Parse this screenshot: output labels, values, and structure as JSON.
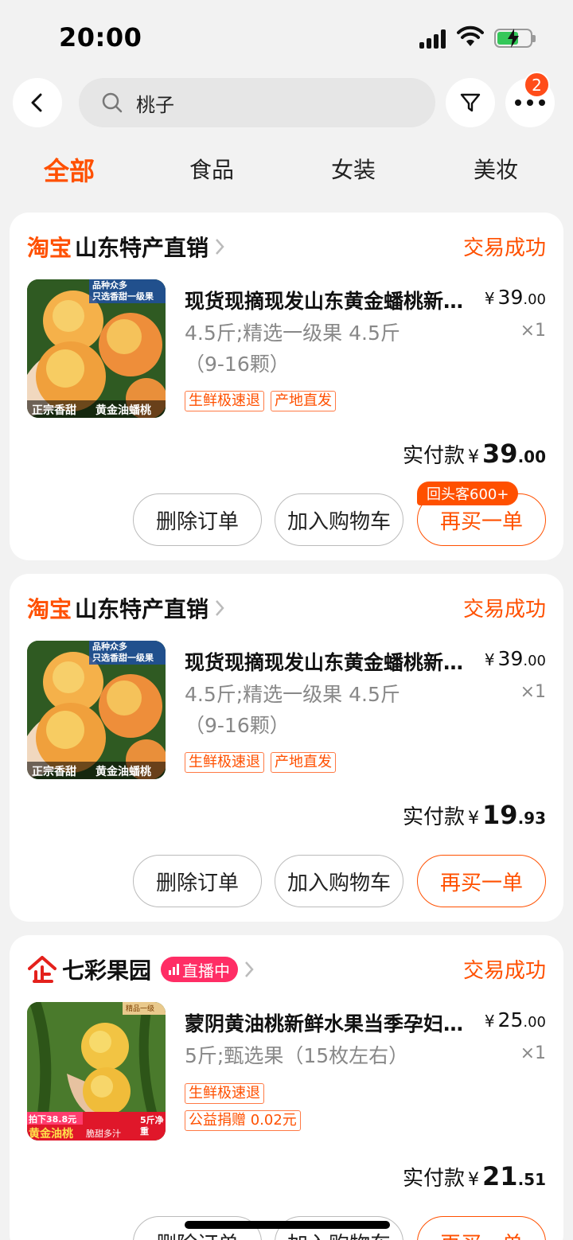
{
  "status_bar": {
    "time": "20:00"
  },
  "header": {
    "search": {
      "value": "桃子"
    },
    "more_badge": "2"
  },
  "tabs": [
    {
      "label": "全部",
      "active": true
    },
    {
      "label": "食品",
      "active": false
    },
    {
      "label": "女装",
      "active": false
    },
    {
      "label": "美妆",
      "active": false
    }
  ],
  "orders": [
    {
      "shop_logo": "淘宝",
      "shop_name": "山东特产直销",
      "status": "交易成功",
      "title": "现货现摘现发山东黄金蟠桃新鲜水果",
      "price_int": "39",
      "price_dec": ".00",
      "spec": "4.5斤;精选一级果 4.5斤（9-16颗）",
      "qty": "×1",
      "tags": [
        "生鲜极速退",
        "产地直发"
      ],
      "thumb_text_top": "品种众多\n只选香甜一级果",
      "thumb_text_bottom_left": "正宗香甜",
      "thumb_text_bottom_right": "黄金油蟠桃",
      "paid_label": "实付款",
      "paid_int": "39",
      "paid_dec": ".00",
      "buttons": {
        "delete": "删除订单",
        "add_cart": "加入购物车",
        "rebuy": "再买一单"
      },
      "rebuy_tip": "回头客600+"
    },
    {
      "shop_logo": "淘宝",
      "shop_name": "山东特产直销",
      "status": "交易成功",
      "title": "现货现摘现发山东黄金蟠桃新鲜水果",
      "price_int": "39",
      "price_dec": ".00",
      "spec": "4.5斤;精选一级果 4.5斤（9-16颗）",
      "qty": "×1",
      "tags": [
        "生鲜极速退",
        "产地直发"
      ],
      "thumb_text_top": "品种众多\n只选香甜一级果",
      "thumb_text_bottom_left": "正宗香甜",
      "thumb_text_bottom_right": "黄金油蟠桃",
      "paid_label": "实付款",
      "paid_int": "19",
      "paid_dec": ".93",
      "buttons": {
        "delete": "删除订单",
        "add_cart": "加入购物车",
        "rebuy": "再买一单"
      }
    },
    {
      "shop_name": "七彩果园",
      "live_label": "直播中",
      "status": "交易成功",
      "title": "蒙阴黄油桃新鲜水果当季孕妇脆甜",
      "price_int": "25",
      "price_dec": ".00",
      "spec": "5斤;甄选果（15枚左右）",
      "qty": "×1",
      "tags": [
        "生鲜极速退"
      ],
      "tags2": [
        "公益捐赠 0.02元"
      ],
      "thumb_text_top": "精品一级",
      "thumb_price": "拍下38.8元",
      "thumb_name": "黄金油桃",
      "thumb_slogan": "脆甜多汁",
      "thumb_weight": "5斤净重",
      "paid_label": "实付款",
      "paid_int": "21",
      "paid_dec": ".51",
      "buttons": {
        "delete": "删除订单",
        "add_cart": "加入购物车",
        "rebuy": "再买一单"
      }
    }
  ],
  "colors": {
    "accent": "#ff5000",
    "live": "#ff2d65",
    "page_bg": "#f2f2f2"
  }
}
